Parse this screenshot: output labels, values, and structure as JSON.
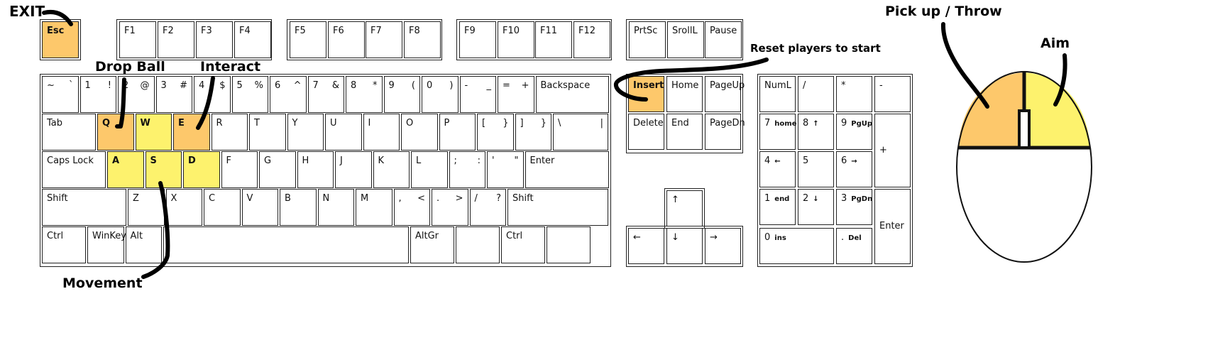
{
  "annotations": {
    "exit": "EXIT",
    "drop_ball": "Drop Ball",
    "interact": "Interact",
    "movement": "Movement",
    "reset": "Reset players to start",
    "pick_up": "Pick up / Throw",
    "aim": "Aim"
  },
  "colors": {
    "orange": "#fdc86b",
    "yellow": "#fdf26d",
    "outline": "#222222"
  },
  "function_row": [
    {
      "id": "esc",
      "label": "Esc",
      "hl": "orange"
    },
    {
      "id": "f1",
      "label": "F1"
    },
    {
      "id": "f2",
      "label": "F2"
    },
    {
      "id": "f3",
      "label": "F3"
    },
    {
      "id": "f4",
      "label": "F4"
    },
    {
      "id": "f5",
      "label": "F5"
    },
    {
      "id": "f6",
      "label": "F6"
    },
    {
      "id": "f7",
      "label": "F7"
    },
    {
      "id": "f8",
      "label": "F8"
    },
    {
      "id": "f9",
      "label": "F9"
    },
    {
      "id": "f10",
      "label": "F10"
    },
    {
      "id": "f11",
      "label": "F11"
    },
    {
      "id": "f12",
      "label": "F12"
    },
    {
      "id": "prtsc",
      "label": "PrtSc"
    },
    {
      "id": "srolll",
      "label": "SrollL"
    },
    {
      "id": "pause",
      "label": "Pause"
    }
  ],
  "number_row": [
    {
      "id": "tilde",
      "label": "~",
      "alt": "`"
    },
    {
      "id": "1",
      "label": "1",
      "alt": "!"
    },
    {
      "id": "2",
      "label": "2",
      "alt": "@"
    },
    {
      "id": "3",
      "label": "3",
      "alt": "#"
    },
    {
      "id": "4",
      "label": "4",
      "alt": "$"
    },
    {
      "id": "5",
      "label": "5",
      "alt": "%"
    },
    {
      "id": "6",
      "label": "6",
      "alt": "^"
    },
    {
      "id": "7",
      "label": "7",
      "alt": "&"
    },
    {
      "id": "8",
      "label": "8",
      "alt": "*"
    },
    {
      "id": "9",
      "label": "9",
      "alt": "("
    },
    {
      "id": "0",
      "label": "0",
      "alt": ")"
    },
    {
      "id": "minus",
      "label": "-",
      "alt": "_"
    },
    {
      "id": "equals",
      "label": "=",
      "alt": "+"
    },
    {
      "id": "backspace",
      "label": "Backspace"
    }
  ],
  "tab_row": [
    {
      "id": "tab",
      "label": "Tab"
    },
    {
      "id": "q",
      "label": "Q",
      "hl": "orange"
    },
    {
      "id": "w",
      "label": "W",
      "hl": "yellow"
    },
    {
      "id": "e",
      "label": "E",
      "hl": "orange"
    },
    {
      "id": "r",
      "label": "R"
    },
    {
      "id": "t",
      "label": "T"
    },
    {
      "id": "y",
      "label": "Y"
    },
    {
      "id": "u",
      "label": "U"
    },
    {
      "id": "i",
      "label": "I"
    },
    {
      "id": "o",
      "label": "O"
    },
    {
      "id": "p",
      "label": "P"
    },
    {
      "id": "lbracket",
      "label": "[",
      "alt": "}"
    },
    {
      "id": "rbracket",
      "label": "]",
      "alt": "}"
    },
    {
      "id": "backslash",
      "label": "\\",
      "alt": "|"
    }
  ],
  "caps_row": [
    {
      "id": "caps",
      "label": "Caps Lock"
    },
    {
      "id": "a",
      "label": "A",
      "hl": "yellow"
    },
    {
      "id": "s",
      "label": "S",
      "hl": "yellow"
    },
    {
      "id": "d",
      "label": "D",
      "hl": "yellow"
    },
    {
      "id": "f",
      "label": "F"
    },
    {
      "id": "g",
      "label": "G"
    },
    {
      "id": "h",
      "label": "H"
    },
    {
      "id": "j",
      "label": "J"
    },
    {
      "id": "k",
      "label": "K"
    },
    {
      "id": "l",
      "label": "L"
    },
    {
      "id": "semicolon",
      "label": ";",
      "alt": ":"
    },
    {
      "id": "quote",
      "label": "'",
      "alt": "\""
    },
    {
      "id": "enter",
      "label": "Enter"
    }
  ],
  "shift_row": [
    {
      "id": "lshift",
      "label": "Shift"
    },
    {
      "id": "z",
      "label": "Z"
    },
    {
      "id": "x",
      "label": "X"
    },
    {
      "id": "c",
      "label": "C"
    },
    {
      "id": "v",
      "label": "V"
    },
    {
      "id": "b",
      "label": "B"
    },
    {
      "id": "n",
      "label": "N"
    },
    {
      "id": "m",
      "label": "M"
    },
    {
      "id": "comma",
      "label": ",",
      "alt": "<"
    },
    {
      "id": "period",
      "label": ".",
      "alt": ">"
    },
    {
      "id": "slash",
      "label": "/",
      "alt": "?"
    },
    {
      "id": "rshift",
      "label": "Shift"
    }
  ],
  "bottom_row": [
    {
      "id": "lctrl",
      "label": "Ctrl"
    },
    {
      "id": "winkey",
      "label": "WinKey"
    },
    {
      "id": "alt",
      "label": "Alt"
    },
    {
      "id": "space",
      "label": ""
    },
    {
      "id": "altgr",
      "label": "AltGr"
    },
    {
      "id": "blank",
      "label": ""
    },
    {
      "id": "rctrl",
      "label": "Ctrl"
    },
    {
      "id": "blank2",
      "label": ""
    }
  ],
  "nav_cluster": [
    {
      "id": "insert",
      "label": "Insert",
      "hl": "orange"
    },
    {
      "id": "home",
      "label": "Home"
    },
    {
      "id": "pageup",
      "label": "PageUp"
    },
    {
      "id": "delete",
      "label": "Delete"
    },
    {
      "id": "end",
      "label": "End"
    },
    {
      "id": "pagedn",
      "label": "PageDn"
    },
    {
      "id": "up",
      "label": "↑"
    },
    {
      "id": "left",
      "label": "←"
    },
    {
      "id": "down",
      "label": "↓"
    },
    {
      "id": "right",
      "label": "→"
    }
  ],
  "numpad": [
    {
      "id": "numl",
      "label": "NumL"
    },
    {
      "id": "np_slash",
      "label": "/"
    },
    {
      "id": "np_star",
      "label": "*"
    },
    {
      "id": "np_minus",
      "label": "-"
    },
    {
      "id": "np7",
      "label": "7",
      "sub": "home"
    },
    {
      "id": "np8",
      "label": "8",
      "sub": "↑"
    },
    {
      "id": "np9",
      "label": "9",
      "sub": "PgUp"
    },
    {
      "id": "np_plus",
      "label": "+"
    },
    {
      "id": "np4",
      "label": "4",
      "sub": "←"
    },
    {
      "id": "np5",
      "label": "5"
    },
    {
      "id": "np6",
      "label": "6",
      "sub": "→"
    },
    {
      "id": "np1",
      "label": "1",
      "sub": "end"
    },
    {
      "id": "np2",
      "label": "2",
      "sub": "↓"
    },
    {
      "id": "np3",
      "label": "3",
      "sub": "PgDn"
    },
    {
      "id": "np_enter",
      "label": "Enter"
    },
    {
      "id": "np0",
      "label": "0",
      "sub": "ins"
    },
    {
      "id": "np_del",
      "label": ".",
      "sub": "Del"
    }
  ],
  "mouse": {
    "left_button": "orange",
    "right_button": "yellow"
  }
}
